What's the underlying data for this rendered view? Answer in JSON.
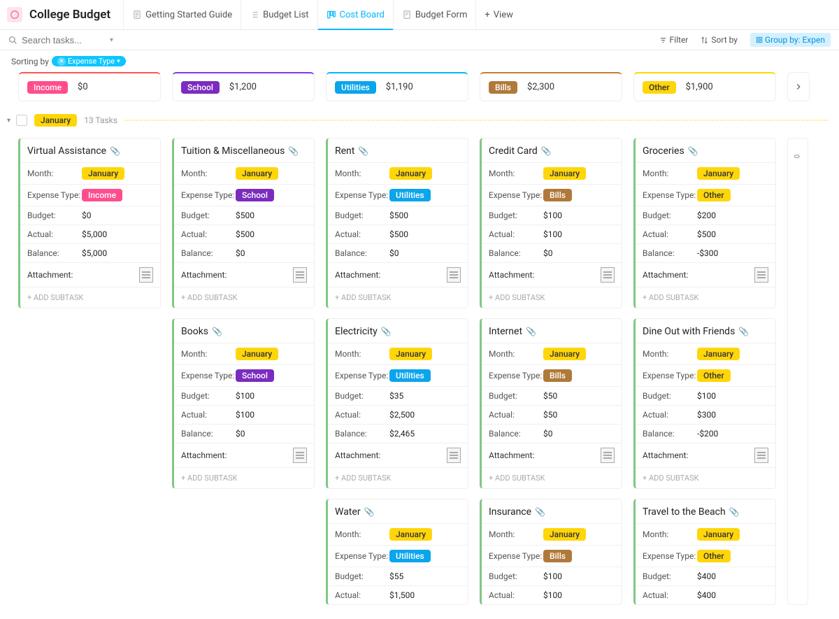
{
  "title": "College Budget",
  "tabs": [
    {
      "label": "Getting Started Guide"
    },
    {
      "label": "Budget List"
    },
    {
      "label": "Cost Board"
    },
    {
      "label": "Budget Form"
    },
    {
      "label": "View"
    }
  ],
  "search_placeholder": "Search tasks...",
  "toolbar": {
    "filter": "Filter",
    "sortby": "Sort by",
    "groupby": "Group by: Expen"
  },
  "sorting_label": "Sorting by",
  "sorting_chip": "Expense Type",
  "columns": [
    {
      "name": "Income",
      "cls": "income",
      "amount": "$0"
    },
    {
      "name": "School",
      "cls": "school",
      "amount": "$1,200"
    },
    {
      "name": "Utilities",
      "cls": "utilities",
      "amount": "$1,190"
    },
    {
      "name": "Bills",
      "cls": "bills",
      "amount": "$2,300"
    },
    {
      "name": "Other",
      "cls": "other",
      "amount": "$1,900"
    }
  ],
  "group": {
    "month": "January",
    "count": "13 Tasks"
  },
  "labels": {
    "month": "Month:",
    "expense": "Expense Type:",
    "budget": "Budget:",
    "actual": "Actual:",
    "balance": "Balance:",
    "attachment": "Attachment:",
    "subtask": "+ ADD SUBTASK"
  },
  "board": [
    [
      {
        "title": "Virtual Assistance",
        "month": "January",
        "type": "Income",
        "typecls": "income",
        "budget": "$0",
        "actual": "$5,000",
        "balance": "$5,000"
      }
    ],
    [
      {
        "title": "Tuition & Miscellaneous",
        "month": "January",
        "type": "School",
        "typecls": "school",
        "budget": "$500",
        "actual": "$500",
        "balance": "$0"
      },
      {
        "title": "Books",
        "month": "January",
        "type": "School",
        "typecls": "school",
        "budget": "$100",
        "actual": "$100",
        "balance": "$0"
      }
    ],
    [
      {
        "title": "Rent",
        "month": "January",
        "type": "Utilities",
        "typecls": "utilities",
        "budget": "$500",
        "actual": "$500",
        "balance": "$0"
      },
      {
        "title": "Electricity",
        "month": "January",
        "type": "Utilities",
        "typecls": "utilities",
        "budget": "$35",
        "actual": "$2,500",
        "balance": "$2,465"
      },
      {
        "title": "Water",
        "month": "January",
        "type": "Utilities",
        "typecls": "utilities",
        "budget": "$55",
        "actual": "$1,500"
      }
    ],
    [
      {
        "title": "Credit Card",
        "month": "January",
        "type": "Bills",
        "typecls": "bills",
        "budget": "$100",
        "actual": "$100",
        "balance": "$0"
      },
      {
        "title": "Internet",
        "month": "January",
        "type": "Bills",
        "typecls": "bills",
        "budget": "$50",
        "actual": "$50",
        "balance": "$0"
      },
      {
        "title": "Insurance",
        "month": "January",
        "type": "Bills",
        "typecls": "bills",
        "budget": "$100",
        "actual": "$100"
      }
    ],
    [
      {
        "title": "Groceries",
        "month": "January",
        "type": "Other",
        "typecls": "other",
        "budget": "$200",
        "actual": "$500",
        "balance": "-$300"
      },
      {
        "title": "Dine Out with Friends",
        "month": "January",
        "type": "Other",
        "typecls": "other",
        "budget": "$100",
        "actual": "$300",
        "balance": "-$200"
      },
      {
        "title": "Travel to the Beach",
        "month": "January",
        "type": "Other",
        "typecls": "other",
        "budget": "$400",
        "actual": "$400"
      }
    ]
  ]
}
